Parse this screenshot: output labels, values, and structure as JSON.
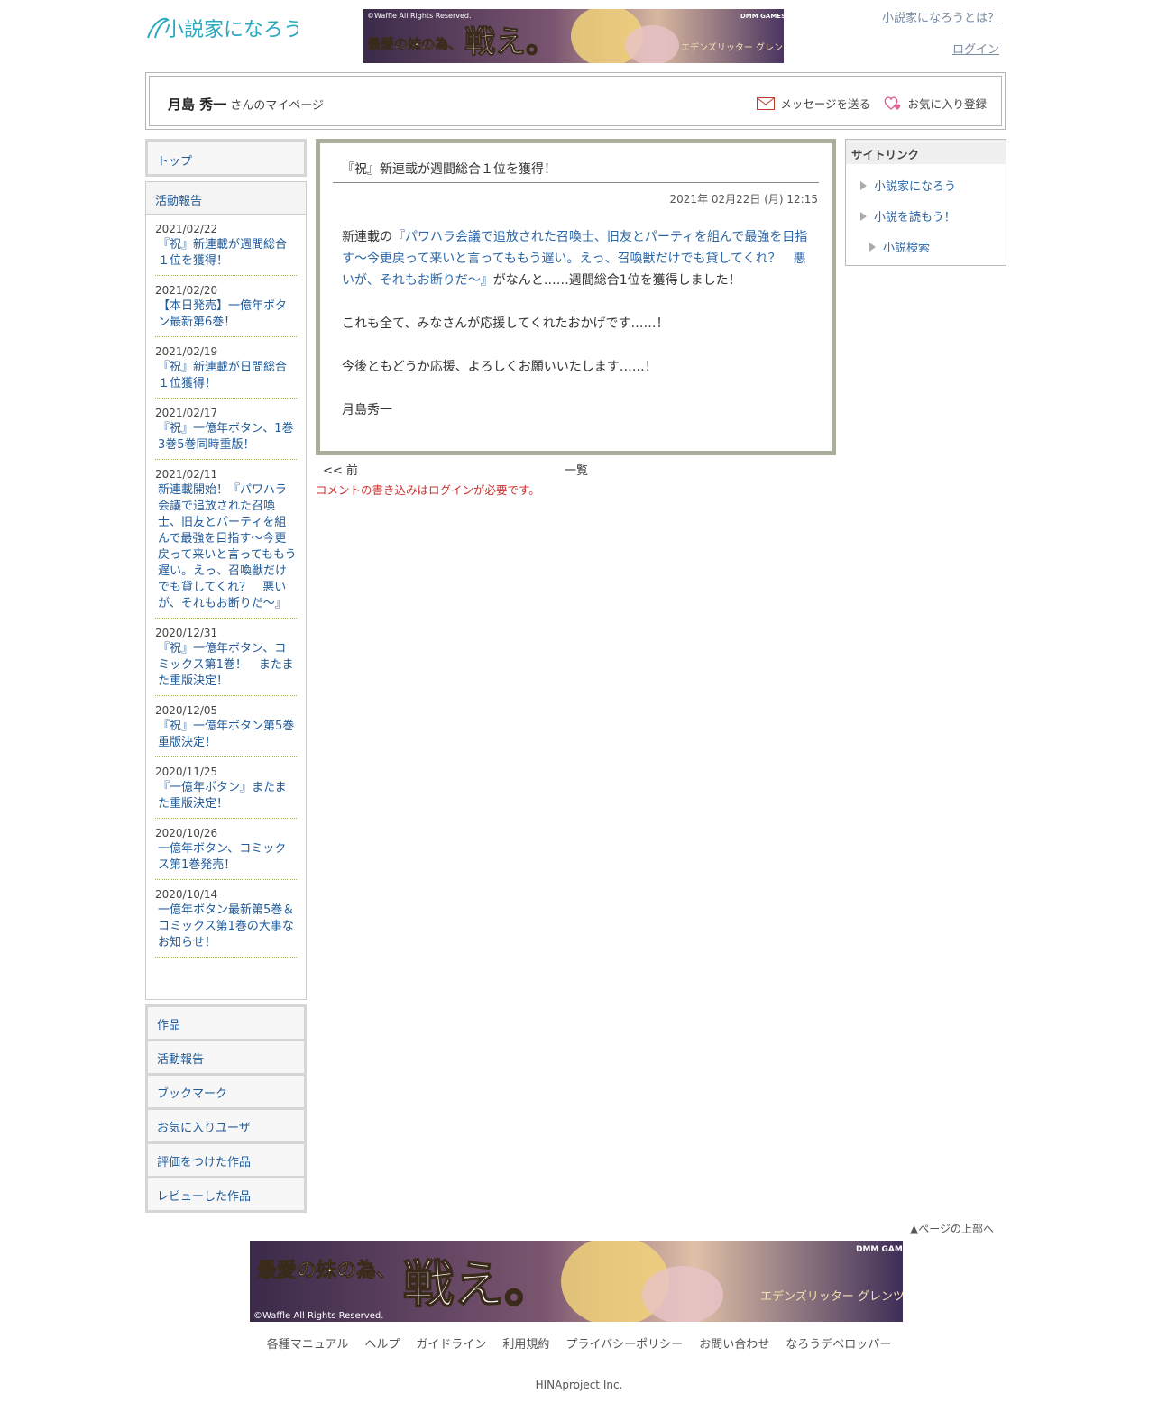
{
  "header": {
    "logo_text": "小説家になろう",
    "banner_top": {
      "copyright": "©Waffle All Rights Reserved.",
      "headline_small": "最愛の妹の為、",
      "headline_big": "戦え。",
      "brand": "DMM GAMES",
      "game_title": "エデンズリッター グレンツェ"
    },
    "link_about": "小説家になろうとは？",
    "link_login": "ログイン"
  },
  "mypage": {
    "user_name": "月島 秀一",
    "suffix": "さんのマイページ",
    "send_message": "メッセージを送る",
    "add_favorite": "お気に入り登録"
  },
  "left_nav": {
    "top": "トップ",
    "report_head": "活動報告",
    "reports": [
      {
        "date": "2021/02/22",
        "title": "『祝』新連載が週間総合１位を獲得！"
      },
      {
        "date": "2021/02/20",
        "title": "【本日発売】一億年ボタン最新第6巻！"
      },
      {
        "date": "2021/02/19",
        "title": "『祝』新連載が日間総合１位獲得！"
      },
      {
        "date": "2021/02/17",
        "title": "『祝』一億年ボタン、1巻3巻5巻同時重版！"
      },
      {
        "date": "2021/02/11",
        "title": "新連載開始！『パワハラ会議で追放された召喚士、旧友とパーティを組んで最強を目指す～今更戻って来いと言ってももう遅い。えっ、召喚獣だけでも貸してくれ？　悪いが、それもお断りだ～』"
      },
      {
        "date": "2020/12/31",
        "title": "『祝』一億年ボタン、コミックス第1巻！　またまた重版決定！"
      },
      {
        "date": "2020/12/05",
        "title": "『祝』一億年ボタン第5巻重版決定！"
      },
      {
        "date": "2020/11/25",
        "title": "『一億年ボタン』またまた重版決定！"
      },
      {
        "date": "2020/10/26",
        "title": "一億年ボタン、コミックス第1巻発売！"
      },
      {
        "date": "2020/10/14",
        "title": "一億年ボタン最新第5巻＆コミックス第1巻の大事なお知らせ！"
      }
    ],
    "bottom": [
      "作品",
      "活動報告",
      "ブックマーク",
      "お気に入りユーザ",
      "評価をつけた作品",
      "レビューした作品"
    ]
  },
  "article": {
    "title": "『祝』新連載が週間総合１位を獲得！",
    "date": "2021年 02月22日 (月) 12:15",
    "p1_prefix": "新連載の",
    "p1_link": "『パワハラ会議で追放された召喚士、旧友とパーティを組んで最強を目指す～今更戻って来いと言ってももう遅い。えっ、召喚獣だけでも貸してくれ？　悪いが、それもお断りだ～』",
    "p1_suffix": "がなんと……週間総合1位を獲得しました！",
    "p2": "これも全て、みなさんが応援してくれたおかげです……！",
    "p3": "今後ともどうか応援、よろしくお願いいたします……！",
    "p4": "月島秀一"
  },
  "pager": {
    "prev": "<< 前",
    "list": "一覧"
  },
  "comment_note": "コメントの書き込みはログインが必要です。",
  "site_links": {
    "head": "サイトリンク",
    "items": [
      "小説家になろう",
      "小説を読もう！",
      "小説検索"
    ]
  },
  "footer": {
    "page_top": "▲ページの上部へ",
    "banner_bottom": {
      "headline_small": "最愛の妹の為、",
      "headline_big": "戦え。",
      "brand": "DMM GAMES",
      "copyright": "©Waffle All Rights Reserved.",
      "game_title": "エデンズリッター グレンツェ"
    },
    "links": [
      "各種マニュアル",
      "ヘルプ",
      "ガイドライン",
      "利用規約",
      "プライバシーポリシー",
      "お問い合わせ",
      "なろうデベロッパー"
    ],
    "copyright": "HINAproject Inc."
  },
  "colors": {
    "link": "#1f5a99",
    "article_border": "#a9ad9c",
    "warning": "#cc3333",
    "logo": "#2aa8bf"
  }
}
